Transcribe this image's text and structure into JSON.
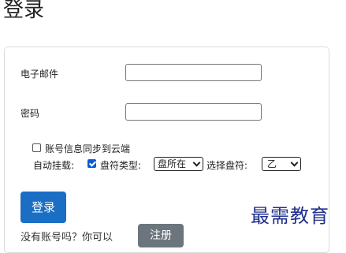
{
  "page": {
    "title": "登录"
  },
  "form": {
    "email_label": "电子邮件",
    "email_value": "",
    "password_label": "密码",
    "password_value": "",
    "sync_label": "账号信息同步到云端",
    "sync_checked": false,
    "automount_label": "自动挂载:",
    "automount_checked": true,
    "drive_type_label": "盘符类型:",
    "drive_type_value": "盘所在",
    "choose_drive_label": "选择盘符:",
    "drive_letter_value": "乙"
  },
  "actions": {
    "login_label": "登录",
    "register_hint": "没有账号吗？你可以",
    "register_label": "注册"
  },
  "watermark": {
    "text": "最需教育"
  },
  "colors": {
    "primary": "#1a6fc4",
    "secondary": "#6c757d",
    "watermark": "#1f2f8c"
  }
}
